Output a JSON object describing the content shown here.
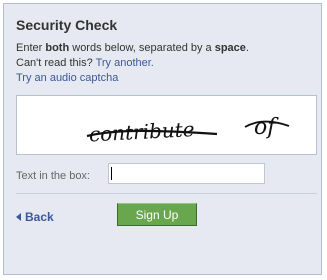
{
  "dialog": {
    "title": "Security Check",
    "instructions": {
      "part1": "Enter ",
      "bold1": "both",
      "part2": " words below, separated by a ",
      "bold2": "space",
      "part3": "."
    },
    "cant_read": "Can't read this? ",
    "try_another": "Try another.",
    "audio_captcha": "Try an audio captcha",
    "captcha_words": [
      "contribute",
      "of"
    ],
    "field_label": "Text in the box:",
    "field_value": "",
    "back_label": "Back",
    "signup_label": "Sign Up"
  },
  "colors": {
    "panel_bg": "#e6e9f1",
    "link": "#3b5998",
    "button_green": "#69a74e"
  },
  "icons": {
    "back": "triangle-left-icon"
  }
}
